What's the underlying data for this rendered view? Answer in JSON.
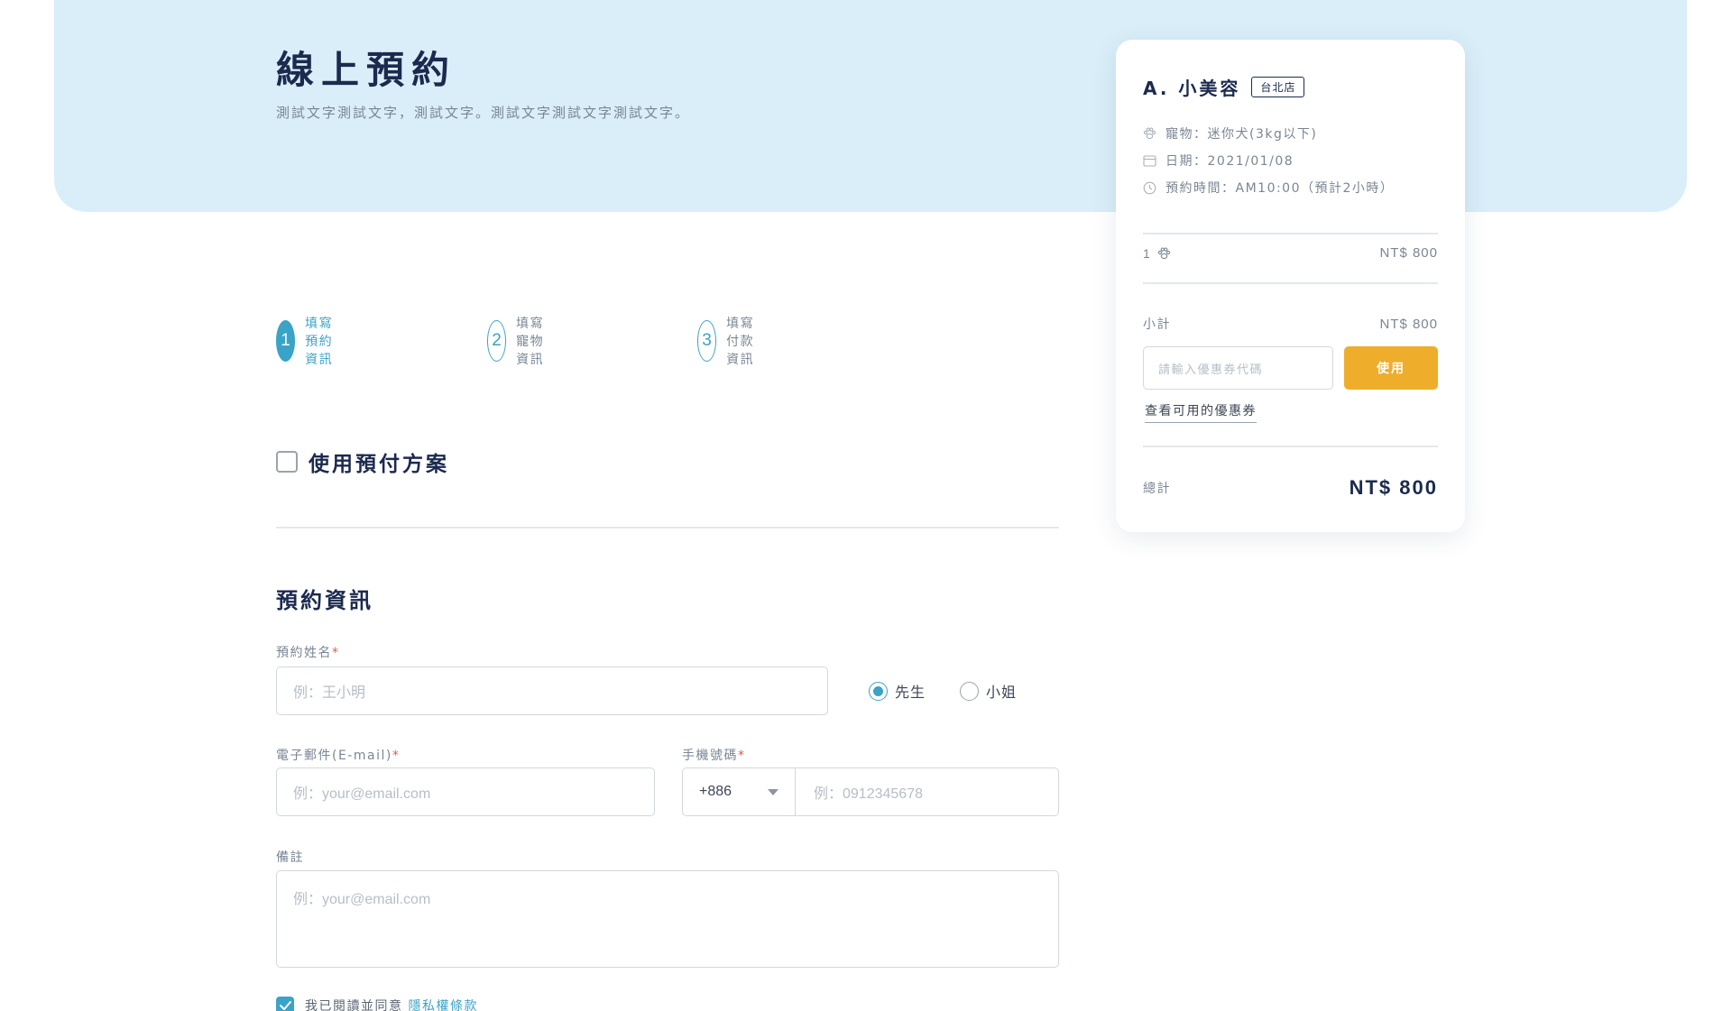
{
  "header": {
    "title": "線上預約",
    "subtitle": "測試文字測試文字，測試文字。測試文字測試文字測試文字。"
  },
  "steps": [
    {
      "number": "1",
      "label": "填寫預約資訊",
      "active": true
    },
    {
      "number": "2",
      "label": "填寫寵物資訊",
      "active": false
    },
    {
      "number": "3",
      "label": "填寫付款資訊",
      "active": false
    }
  ],
  "prepaid": {
    "label": "使用預付方案",
    "checked": false
  },
  "form": {
    "section_title": "預約資訊",
    "name_label": "預約姓名",
    "name_placeholder": "例：王小明",
    "required_mark": "*",
    "gender_options": [
      {
        "label": "先生",
        "selected": true
      },
      {
        "label": "小姐",
        "selected": false
      }
    ],
    "email_label": "電子郵件(E-mail)",
    "email_placeholder": "例：your@email.com",
    "phone_label": "手機號碼",
    "phone_code": "+886",
    "phone_placeholder": "例：0912345678",
    "note_label": "備註",
    "note_placeholder": "例：your@email.com",
    "agree_text": "我已閱讀並同意",
    "agree_link": "隱私權條款",
    "agree_checked": true
  },
  "summary": {
    "shop_name": "A. 小美容",
    "shop_badge": "台北店",
    "pet": "寵物：迷你犬(3kg以下)",
    "date": "日期：2021/01/08",
    "time": "預約時間：AM10:00（預計2小時）",
    "item_qty": "1",
    "item_price": "NT$ 800",
    "subtotal_label": "小計",
    "subtotal": "NT$ 800",
    "coupon_placeholder": "請輸入優惠券代碼",
    "coupon_button": "使用",
    "coupon_link": "查看可用的優惠券",
    "total_label": "總計",
    "total": "NT$ 800"
  },
  "colors": {
    "accent": "#3aa3c8",
    "hero_bg": "#d9eef8",
    "button": "#efad2c",
    "title": "#1b2a4e",
    "required": "#e05a4e"
  },
  "icons": [
    "paw-icon",
    "calendar-icon",
    "clock-icon",
    "check-icon",
    "chevron-down-icon"
  ]
}
